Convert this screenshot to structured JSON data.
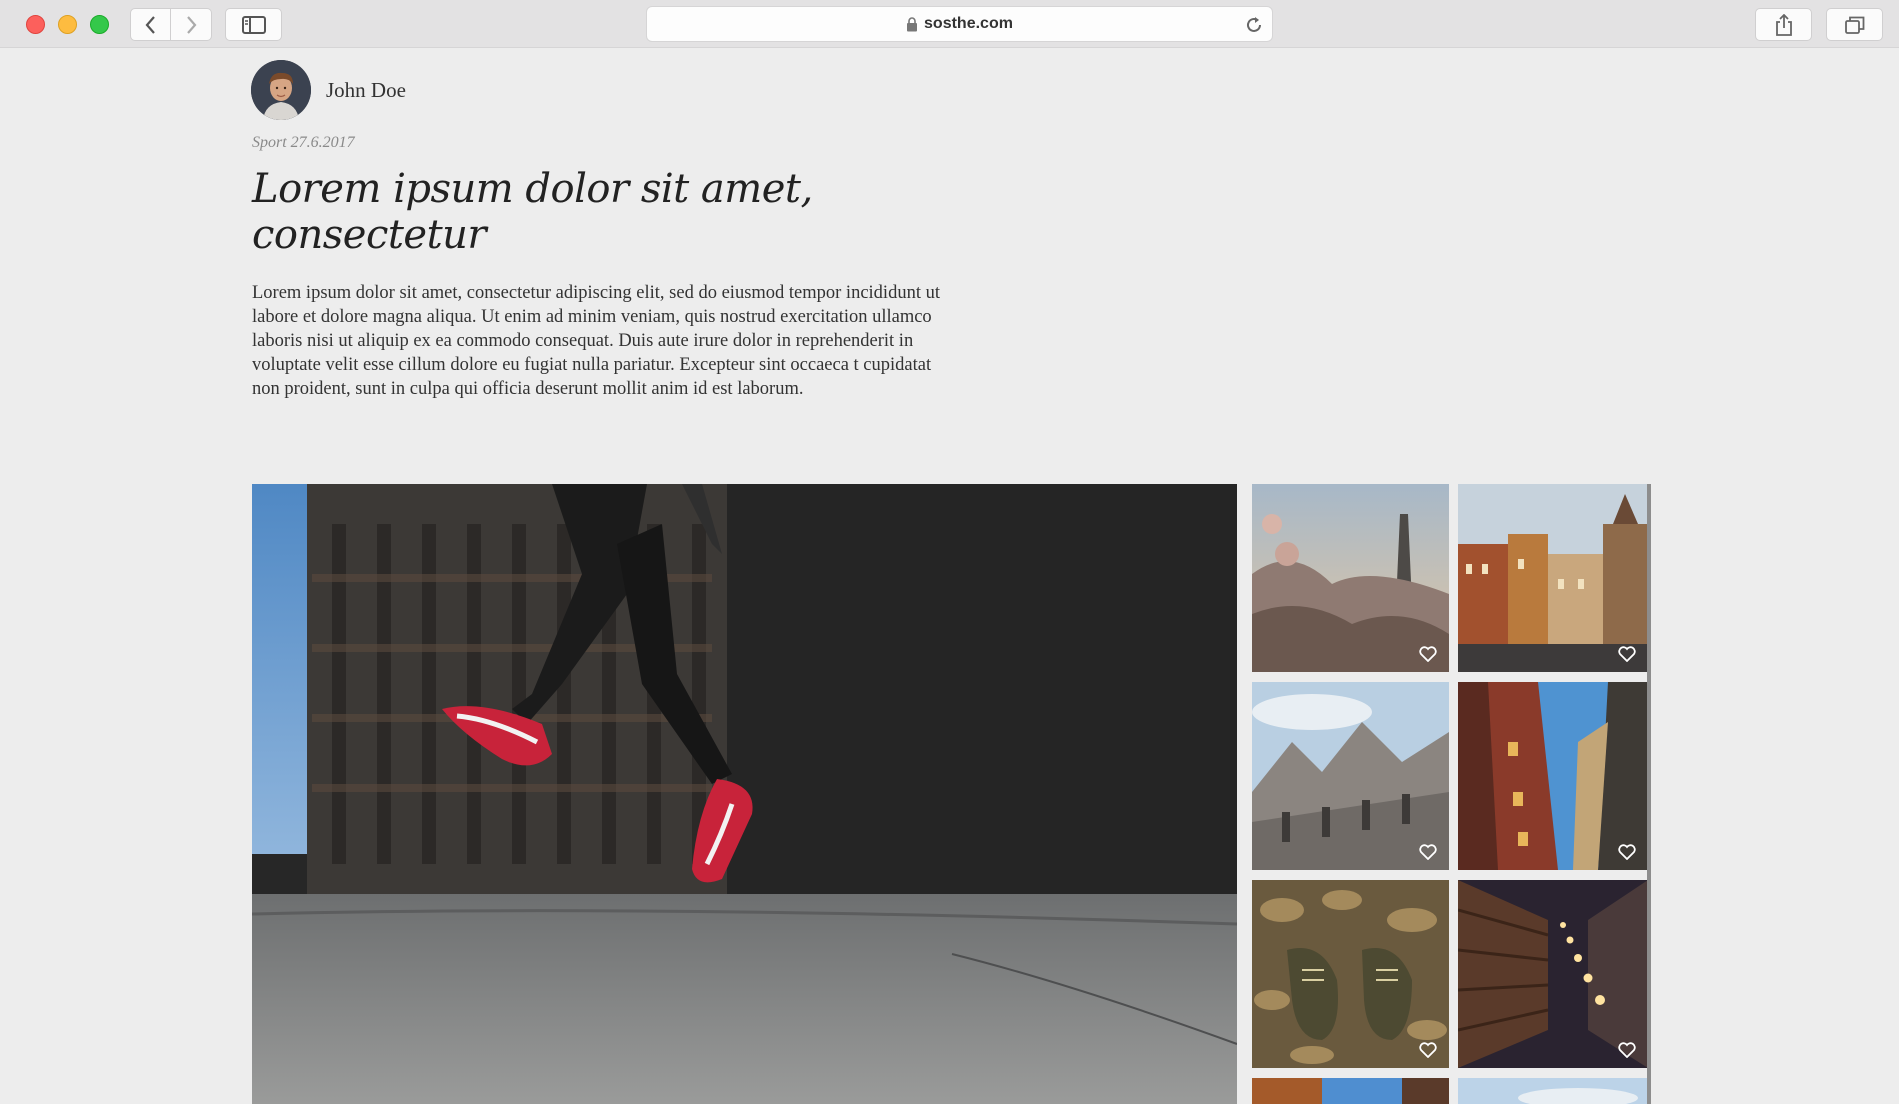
{
  "browser": {
    "url": "sosthe.com"
  },
  "article": {
    "author_name": "John Doe",
    "meta": "Sport 27.6.2017",
    "title": "Lorem ipsum dolor sit amet, consectetur",
    "body": "Lorem ipsum dolor sit amet, consectetur adipiscing elit, sed do eiusmod tempor incididunt ut labore et dolore magna aliqua. Ut enim ad minim veniam, quis nostrud exercitation ullamco laboris nisi ut aliquip ex ea commodo consequat. Duis aute irure dolor in reprehenderit in voluptate velit esse cillum dolore eu fugiat nulla pariatur. Excepteur sint occaeca t cupidatat non proident, sunt in culpa qui officia deserunt mollit anim id est laborum."
  },
  "gallery": {
    "hero_icon": "photo-jumping-sneakers",
    "thumbnails": [
      {
        "icon": "photo-obelisk-blossoms"
      },
      {
        "icon": "photo-old-town-square"
      },
      {
        "icon": "photo-gothic-cathedral"
      },
      {
        "icon": "photo-narrow-street"
      },
      {
        "icon": "photo-boots-leaves"
      },
      {
        "icon": "photo-library-shelves"
      },
      {
        "icon": "photo-street-partial"
      },
      {
        "icon": "photo-sky-partial"
      }
    ]
  },
  "colors": {
    "page_bg": "#ededed",
    "chrome_bg": "#e3e2e3",
    "text": "#333333",
    "meta": "#8a8a8a"
  }
}
